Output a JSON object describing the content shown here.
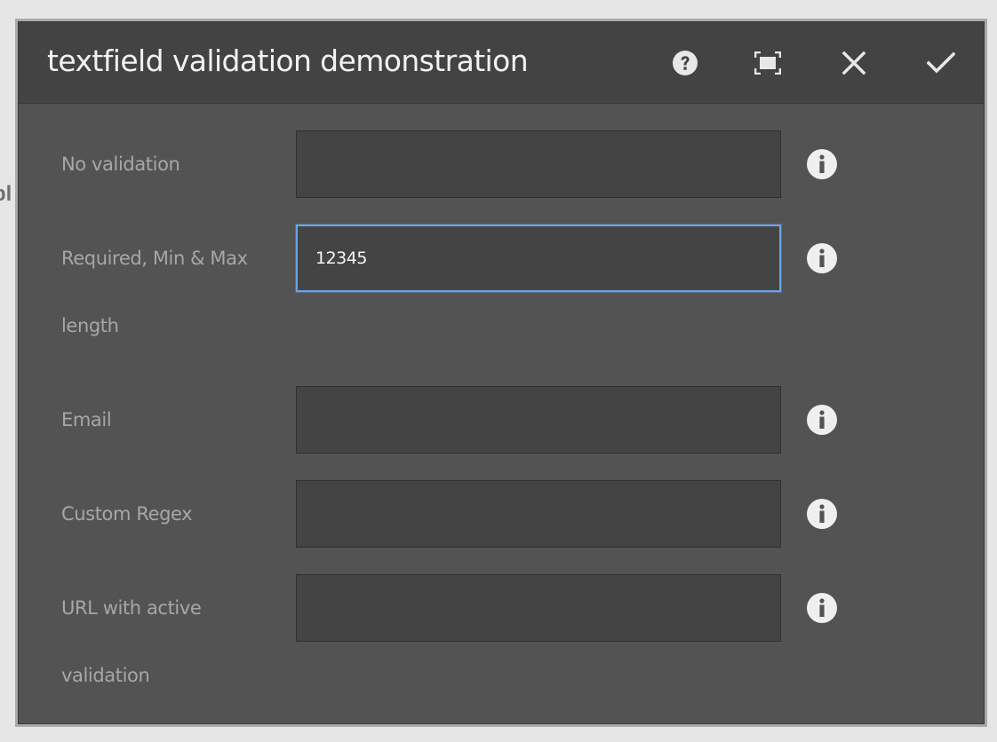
{
  "background_page": {
    "heading_fragment": "pl",
    "code_fragments": []
  },
  "dialog": {
    "title": "textfield validation demonstration",
    "header_buttons": {
      "help_icon": "question-circle-icon",
      "fullscreen_icon": "fullscreen-icon",
      "close_icon": "close-icon",
      "confirm_icon": "checkmark-icon"
    },
    "fields": [
      {
        "label_line1": "No validation",
        "label_line2": "",
        "value": "",
        "info_icon": "info-icon"
      },
      {
        "label_line1": "Required, Min & Max",
        "label_line2": "length",
        "value": "12345",
        "info_icon": "info-icon"
      },
      {
        "label_line1": "Email",
        "label_line2": "",
        "value": "",
        "info_icon": "info-icon"
      },
      {
        "label_line1": "Custom Regex",
        "label_line2": "",
        "value": "",
        "info_icon": "info-icon"
      },
      {
        "label_line1": "URL with active",
        "label_line2": "validation",
        "value": "",
        "info_icon": "info-icon"
      }
    ]
  },
  "colors": {
    "dialog_bg": "#535353",
    "header_bg": "#434343",
    "field_bg": "#444444",
    "focus_ring": "#6aa3e6",
    "label_text": "#a7a7a7",
    "title_text": "#f2f2f2"
  }
}
